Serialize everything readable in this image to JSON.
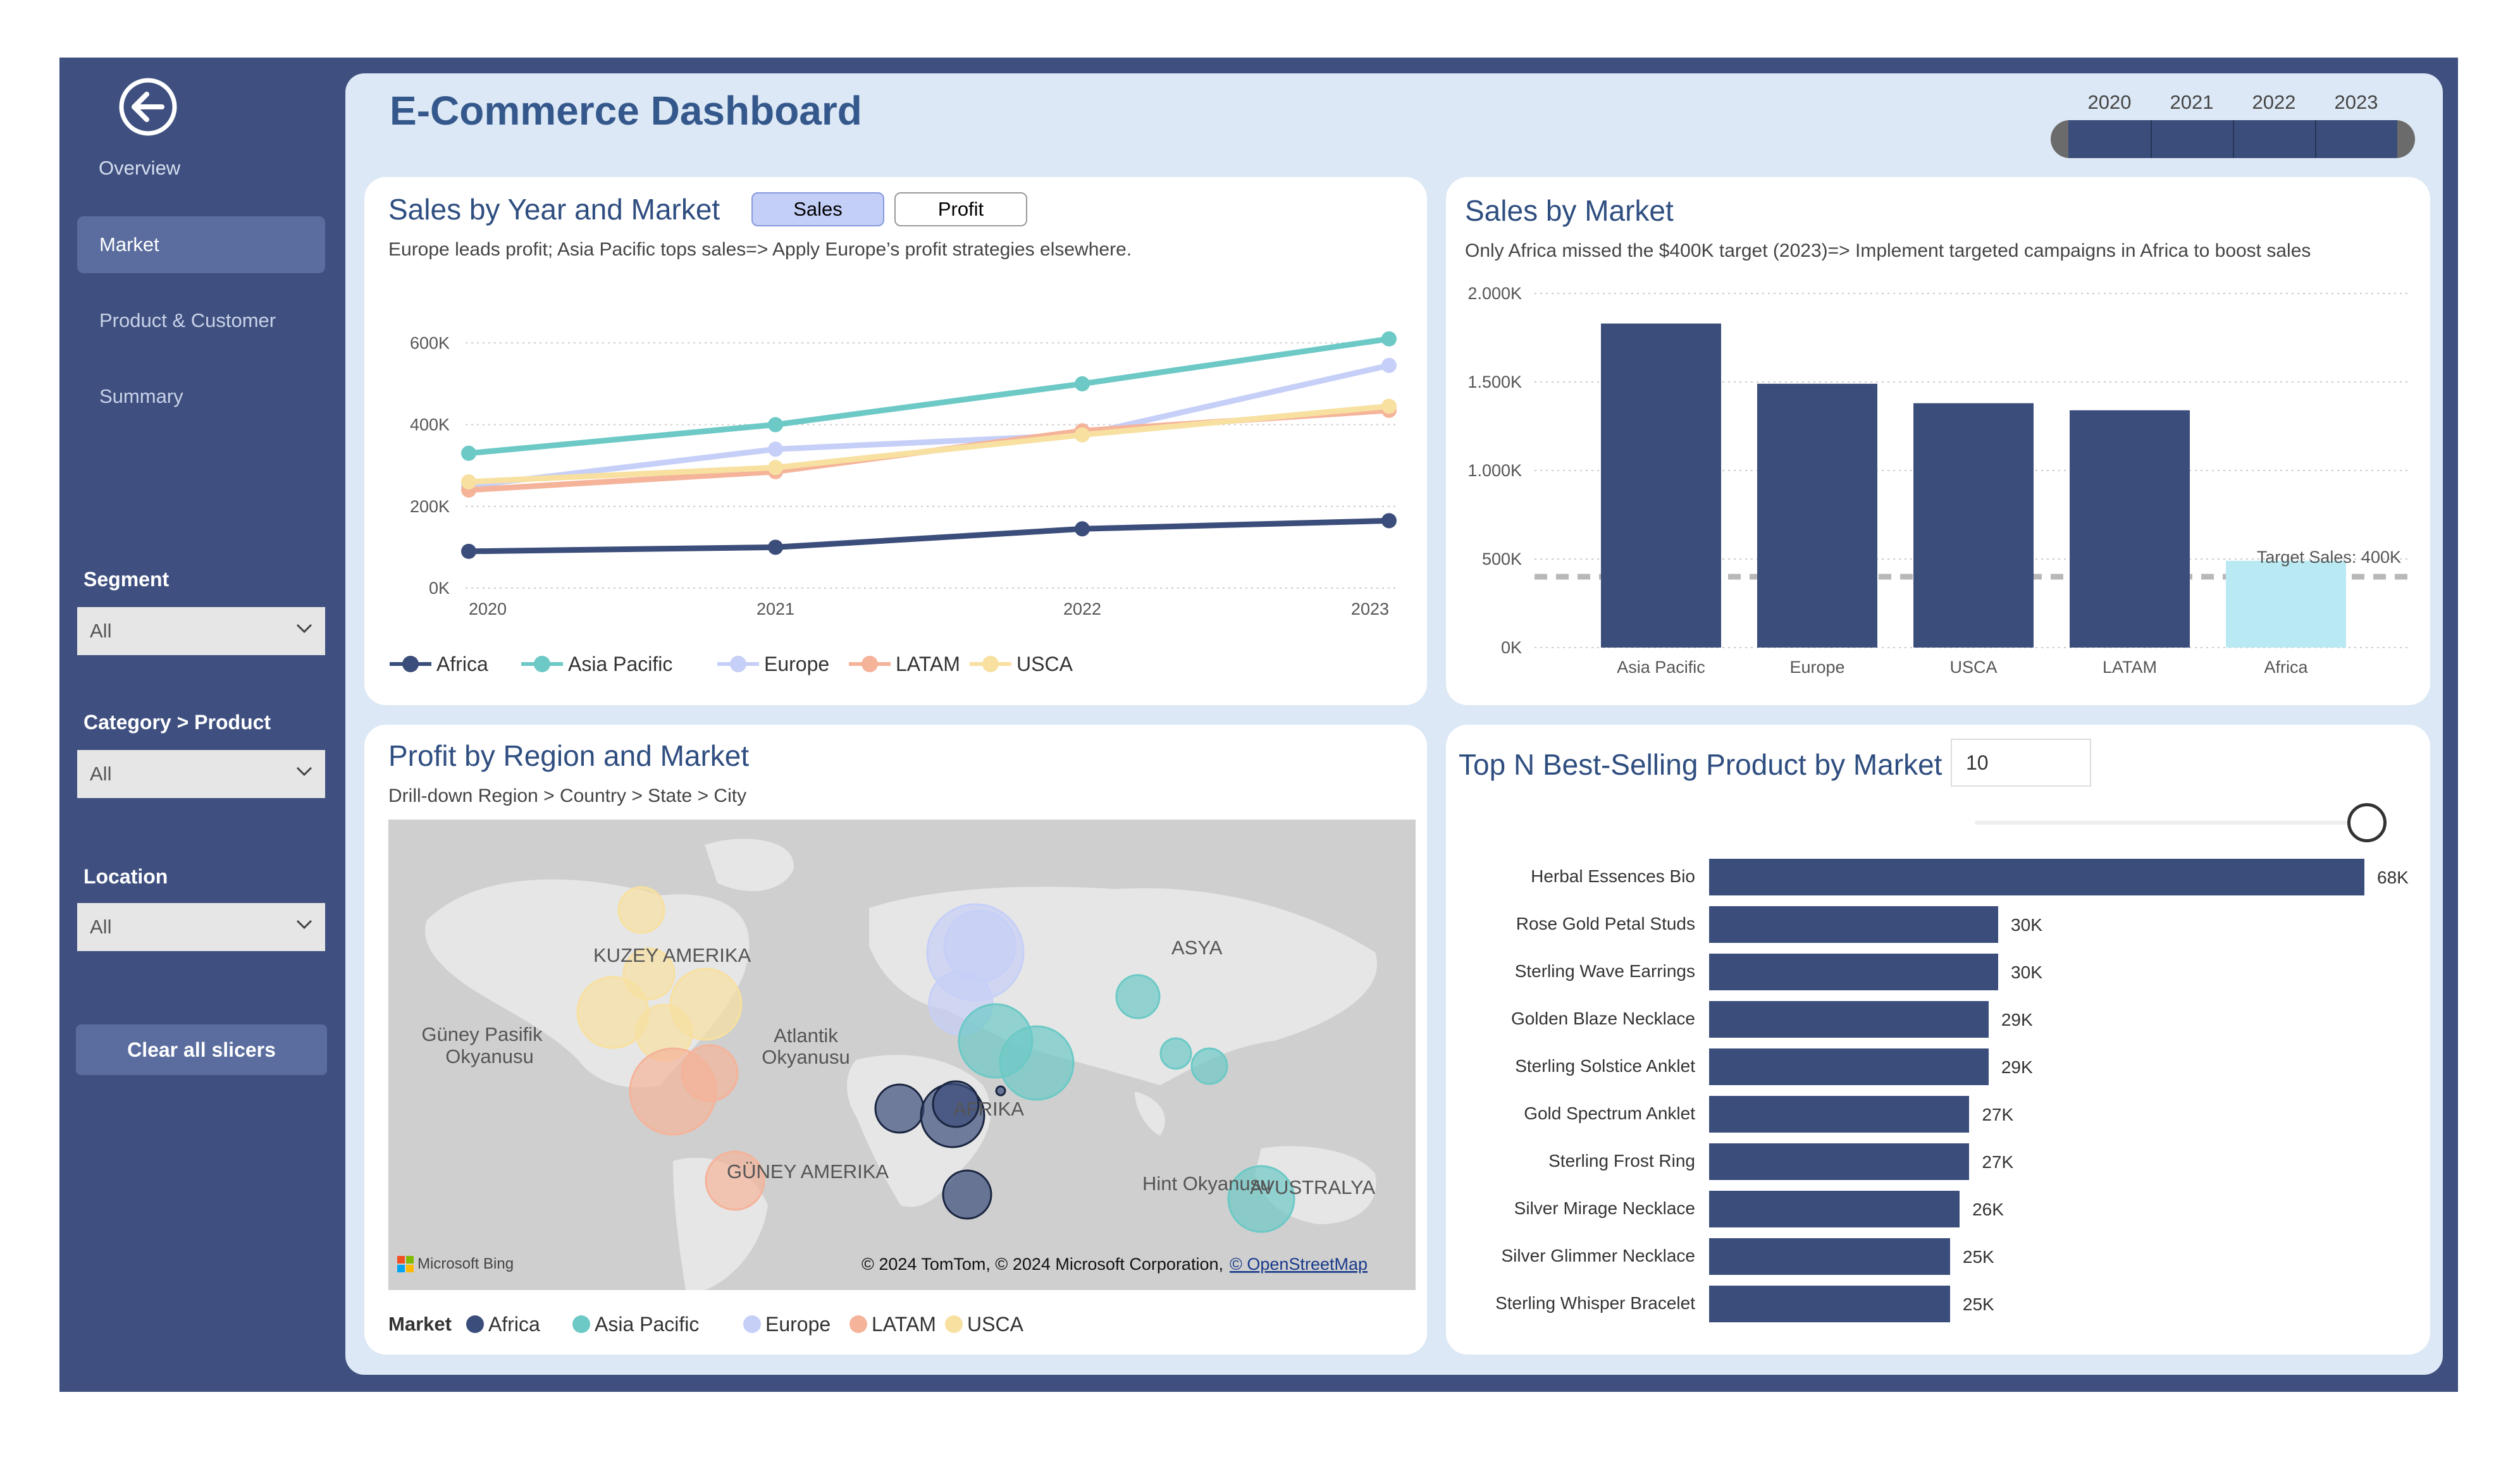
{
  "nav": {
    "overview_label": "Overview",
    "items": [
      "Market",
      "Product & Customer",
      "Summary"
    ]
  },
  "filters": {
    "segment": {
      "label": "Segment",
      "value": "All"
    },
    "category": {
      "label": "Category > Product",
      "value": "All"
    },
    "location": {
      "label": "Location",
      "value": "All"
    },
    "clear_label": "Clear all slicers"
  },
  "header": {
    "title": "E-Commerce Dashboard",
    "years": [
      "2020",
      "2021",
      "2022",
      "2023"
    ]
  },
  "line_card": {
    "title": "Sales by Year and Market",
    "toggle_sales": "Sales",
    "toggle_profit": "Profit",
    "subtitle": "Europe leads profit; Asia Pacific tops sales=> Apply Europe’s profit strategies elsewhere."
  },
  "bar_card": {
    "title": "Sales by Market",
    "subtitle": "Only Africa missed the $400K target (2023)=> Implement targeted campaigns in Africa to boost sales",
    "target_label": "Target Sales: 400K"
  },
  "map_card": {
    "title": "Profit by Region and Market",
    "subtitle": "Drill-down Region > Country > State > City",
    "legend_title": "Market",
    "labels": {
      "north_america": "KUZEY AMERIKA",
      "south_america": "GÜNEY AMERIKA",
      "asia": "ASYA",
      "africa": "AFRIKA",
      "australia": "AVUSTRALYA",
      "pacific_1": "Güney Pasifik",
      "pacific_2": "Okyanusu",
      "atlantic_1": "Atlantik",
      "atlantic_2": "Okyanusu",
      "indian": "Hint Okyanusu"
    },
    "bing_label": "Microsoft Bing",
    "attribution": "© 2024 TomTom, © 2024 Microsoft Corporation,",
    "osm_link": "© OpenStreetMap"
  },
  "topn_card": {
    "title": "Top N Best-Selling Product by Market",
    "n_value": "10",
    "slider_fraction": 1.0
  },
  "colors": {
    "Africa": "#3b4d7a",
    "Asia Pacific": "#6cc9c6",
    "Europe": "#c6cff7",
    "LATAM": "#f5b39a",
    "USCA": "#f7e0a0"
  },
  "chart_data": [
    {
      "type": "line",
      "x": [
        "2020",
        "2021",
        "2022",
        "2023"
      ],
      "series": [
        {
          "name": "Africa",
          "values": [
            90,
            100,
            145,
            165
          ]
        },
        {
          "name": "Asia Pacific",
          "values": [
            330,
            400,
            500,
            610
          ]
        },
        {
          "name": "Europe",
          "values": [
            250,
            340,
            375,
            545
          ]
        },
        {
          "name": "LATAM",
          "values": [
            240,
            285,
            385,
            435
          ]
        },
        {
          "name": "USCA",
          "values": [
            260,
            295,
            375,
            445
          ]
        }
      ],
      "ylim": [
        0,
        650
      ],
      "yticks": [
        "0K",
        "200K",
        "400K",
        "600K"
      ],
      "ytick_values": [
        0,
        200,
        400,
        600
      ],
      "legend": "bottom",
      "grid": true
    },
    {
      "type": "bar",
      "categories": [
        "Asia Pacific",
        "Europe",
        "USCA",
        "LATAM",
        "Africa"
      ],
      "values": [
        1830,
        1490,
        1380,
        1340,
        490
      ],
      "ylim": [
        0,
        2000
      ],
      "yticks": [
        "0K",
        "500K",
        "1.000K",
        "1.500K",
        "2.000K"
      ],
      "ytick_values": [
        0,
        500,
        1000,
        1500,
        2000
      ],
      "target": 400,
      "highlight": "Africa"
    },
    {
      "type": "bar",
      "orientation": "horizontal",
      "categories": [
        "Herbal Essences Bio",
        "Rose Gold Petal Studs",
        "Sterling Wave Earrings",
        "Golden Blaze Necklace",
        "Sterling Solstice Anklet",
        "Gold Spectrum Anklet",
        "Sterling Frost Ring",
        "Silver Mirage Necklace",
        "Silver Glimmer Necklace",
        "Sterling Whisper Bracelet"
      ],
      "values": [
        68,
        30,
        30,
        29,
        29,
        27,
        27,
        26,
        25,
        25
      ],
      "value_labels": [
        "68K",
        "30K",
        "30K",
        "29K",
        "29K",
        "27K",
        "27K",
        "26K",
        "25K",
        "25K"
      ]
    }
  ]
}
